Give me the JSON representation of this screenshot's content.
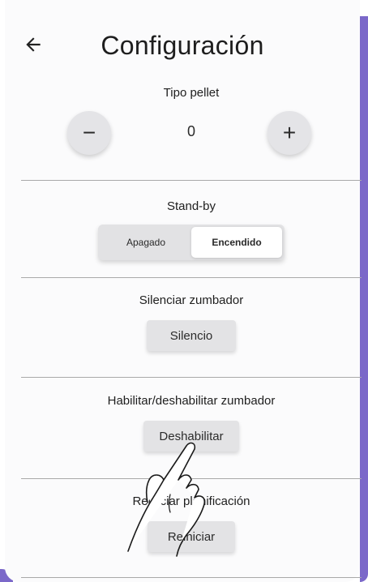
{
  "header": {
    "title": "Configuración"
  },
  "icons": {
    "back": "arrow-left-icon",
    "minus": "minus-icon",
    "plus": "plus-icon",
    "hand": "hand-pointer-icon"
  },
  "pellet": {
    "label": "Tipo pellet",
    "value": "0",
    "minus_label": "−",
    "plus_label": "+"
  },
  "standby": {
    "label": "Stand-by",
    "off_label": "Apagado",
    "on_label": "Encendido",
    "selected": "Encendido"
  },
  "mute": {
    "label": "Silenciar zumbador",
    "button": "Silencio"
  },
  "buzzer": {
    "label": "Habilitar/deshabilitar zumbador",
    "button": "Deshabilitar"
  },
  "reset": {
    "label": "Reiniciar planificación",
    "button": "Reiniciar"
  },
  "colors": {
    "accent": "#7b68c9",
    "button_bg": "#e3e3e5",
    "divider": "#a9a9a9"
  }
}
